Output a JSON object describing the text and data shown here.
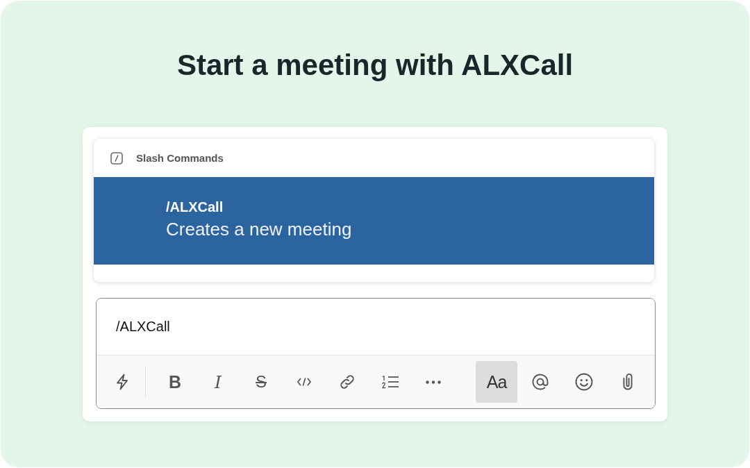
{
  "heading": "Start a meeting with ALXCall",
  "command_menu": {
    "header": "Slash Commands",
    "items": [
      {
        "command": "/ALXCall",
        "description": "Creates a new meeting",
        "selected": true
      }
    ]
  },
  "composer": {
    "value": "/ALXCall",
    "toolbar": [
      {
        "kind": "leading",
        "items": [
          {
            "kind": "shortcuts",
            "selected": false
          }
        ]
      },
      {
        "kind": "formatting",
        "items": [
          {
            "kind": "bold",
            "label": "B",
            "selected": false
          },
          {
            "kind": "italic",
            "label": "I",
            "selected": false
          },
          {
            "kind": "strike",
            "label": "S",
            "selected": false
          },
          {
            "kind": "code",
            "selected": false
          },
          {
            "kind": "link",
            "selected": false
          },
          {
            "kind": "numbered-list",
            "selected": false
          },
          {
            "kind": "more",
            "selected": false
          }
        ]
      },
      {
        "kind": "insert",
        "items": [
          {
            "kind": "format",
            "label": "Aa",
            "selected": true
          },
          {
            "kind": "mention",
            "selected": false
          },
          {
            "kind": "emoji",
            "selected": false
          },
          {
            "kind": "attach",
            "selected": false
          }
        ]
      }
    ]
  }
}
